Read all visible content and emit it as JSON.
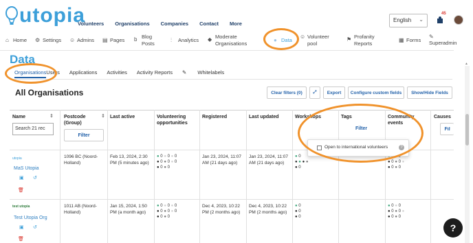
{
  "brand": {
    "logo_text": "utopia",
    "accent": "#3c9fd9",
    "highlight": "#f0922b"
  },
  "topnav": [
    "Volunteers",
    "Organisations",
    "Companies",
    "Contact",
    "More"
  ],
  "language": {
    "selected": "English"
  },
  "notifications": {
    "count": "45"
  },
  "menu": {
    "home": "Home",
    "settings": "Settings",
    "admins": "Admins",
    "pages": "Pages",
    "blog_line1": "Blog",
    "blog_line2": "Posts",
    "analytics": "Analytics",
    "moderate_line1": "Moderate",
    "moderate_line2": "Organisations",
    "data": "Data",
    "volunteer_line1": "Volunteer",
    "volunteer_line2": "pool",
    "profanity_line1": "Profanity",
    "profanity_line2": "Reports",
    "forms": "Forms",
    "superadmin": "Superadmin"
  },
  "page_title": "Data",
  "tabs": [
    "Organisations",
    "Users",
    "Applications",
    "Activities",
    "Activity Reports",
    "Whitelabels"
  ],
  "section_title": "All Organisations",
  "toolbar": {
    "clear_filters": "Clear filters (0)",
    "export": "Export",
    "configure": "Configure custom fields",
    "show_hide": "Show/Hide Fields"
  },
  "table": {
    "headers": {
      "name": "Name",
      "postcode_line1": "Postcode",
      "postcode_line2": "(Group)",
      "last_active": "Last active",
      "volunteering_line1": "Volunteering",
      "volunteering_line2": "opportunities",
      "registered": "Registered",
      "last_updated": "Last updated",
      "workshops": "Workshops",
      "tags": "Tags",
      "community_line1": "Community",
      "community_line2": "events",
      "causes": "Causes"
    },
    "search_value": "Search 21 rec",
    "filter_label": "Filter",
    "rows": [
      {
        "logo_text": "utopia",
        "name": "MaS Utopia",
        "postcode_line1": "1096 BC (Noord-",
        "postcode_line2": "Holland)",
        "last_active_line1": "Feb 13, 2024, 2:30",
        "last_active_line2": "PM (5 minutes ago)",
        "registered_line1": "Jan 23, 2024, 11:07",
        "registered_line2": "AM (21 days ago)",
        "updated_line1": "Jan 23, 2024, 11:07",
        "updated_line2": "AM (21 days ago)"
      },
      {
        "logo_text": "test utopia",
        "name": "Test Utopia Org",
        "postcode_line1": "1011 AB (Noord-",
        "postcode_line2": "Holland)",
        "last_active_line1": "Jan 15, 2024, 1:50",
        "last_active_line2": "PM (a month ago)",
        "registered_line1": "Dec 4, 2023, 10:22",
        "registered_line2": "PM (2 months ago)",
        "updated_line1": "Dec 4, 2023, 10:22",
        "updated_line2": "PM (2 months ago)"
      }
    ],
    "zero": "0"
  },
  "tags_popover": {
    "label": "Open to international volunteers",
    "help": "?"
  },
  "help_button": "?"
}
